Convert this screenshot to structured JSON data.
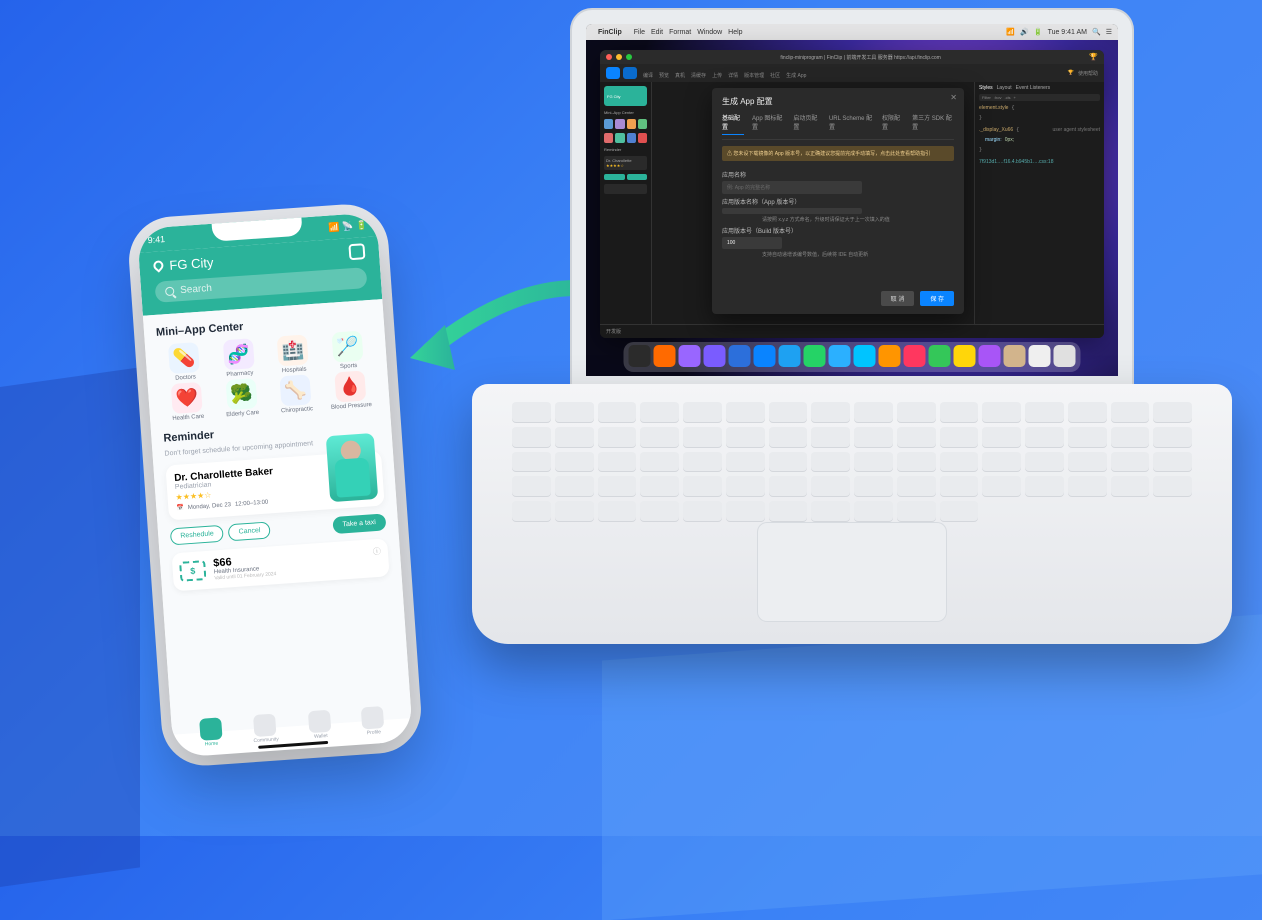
{
  "mac_menubar": {
    "app": "FinClip",
    "menus": [
      "File",
      "Edit",
      "Format",
      "Window",
      "Help"
    ],
    "time": "Tue 9:41 AM"
  },
  "ide": {
    "title": "finclip-miniprogram | FinClip | 前端开发工具 服务器 https://api.finclip.com",
    "toolbar_labels": [
      "编译",
      "预览",
      "真机",
      "清缓存",
      "上传",
      "详情",
      "版本管理",
      "社区",
      "生成 App"
    ],
    "credit_label": "使用帮助",
    "sidebar": {
      "loc": "FG City",
      "section": "Mini–App Center",
      "reminder": "Reminder",
      "doctor": "Dr. Charollette"
    },
    "devtools": {
      "tabs": [
        "Styles",
        "Layout",
        "Event Listeners"
      ],
      "filter": "Filter",
      "hov": ":hov",
      "cls": ".cls",
      "plus": "+",
      "rule_selector": "element.style",
      "rule2_selector": "._display_Xu66",
      "margin_prop": "margin:",
      "margin_val": "0px;",
      "agent": "user agent stylesheet",
      "css_link": "7f913d1….f16.4.b945b1….css:18"
    },
    "bottombar": {
      "label": "开发版"
    }
  },
  "modal": {
    "title": "生成 App 配置",
    "tabs": [
      "基础配置",
      "App 图标配置",
      "启动页配置",
      "URL Scheme 配置",
      "权限配置",
      "第三方 SDK 配置"
    ],
    "warn": "⚠ 您未设下载镜像的 App 版本号，以正确建议您提前完成手动填写，点击此处查看帮助指引",
    "field1_label": "应用名称",
    "field1_placeholder": "例: App 的完整名称",
    "field2_label": "应用版本名称（App 版本号）",
    "field2_hint": "请按照 x.y.z 方式命名，升级时请保证大于上一次填入的值",
    "field3_label": "应用版本号（Build 版本号）",
    "field3_value": "100",
    "field3_hint": "支持自动递增该编号数值，后续将 IDE 自动更新",
    "cancel": "取 消",
    "save": "保 存"
  },
  "phone": {
    "status_time": "9:41",
    "location": "FG City",
    "search_placeholder": "Search",
    "section_title": "Mini–App Center",
    "apps": [
      {
        "label": "Doctors",
        "emoji": "💊",
        "bg": "#eaf4ff"
      },
      {
        "label": "Pharmacy",
        "emoji": "🧬",
        "bg": "#f3eaff"
      },
      {
        "label": "Hospitals",
        "emoji": "🏥",
        "bg": "#fff3ea"
      },
      {
        "label": "Sports",
        "emoji": "🏸",
        "bg": "#eafff1"
      },
      {
        "label": "Health Care",
        "emoji": "❤️",
        "bg": "#ffeaf1"
      },
      {
        "label": "Elderly Care",
        "emoji": "🥦",
        "bg": "#eafff8"
      },
      {
        "label": "Chiropractic",
        "emoji": "🦴",
        "bg": "#eaf2ff"
      },
      {
        "label": "Blood Pressure",
        "emoji": "🩸",
        "bg": "#ffeaea"
      }
    ],
    "reminder_title": "Reminder",
    "reminder_sub": "Don't forget schedule for upcoming appointment",
    "doctor": {
      "name": "Dr. Charollette Baker",
      "spec": "Pediatrician",
      "stars": "★★★★☆",
      "date": "Monday, Dec 23",
      "time": "12:00–13:00"
    },
    "buttons": {
      "reschedule": "Reshedule",
      "cancel": "Cancel",
      "taxi": "Take a taxi"
    },
    "price": {
      "amount": "$66",
      "label": "Health Insurance",
      "sub": "Valid until 01 February 2024",
      "ticket": "$"
    },
    "tabs": [
      {
        "label": "Home",
        "bg": "#2bb39a"
      },
      {
        "label": "Community",
        "bg": "#e5e7eb"
      },
      {
        "label": "Wallet",
        "bg": "#e5e7eb"
      },
      {
        "label": "Profile",
        "bg": "#e5e7eb"
      }
    ]
  },
  "dock_colors": [
    "#2b2b2b",
    "#ff6a00",
    "#9966ff",
    "#7a5cff",
    "#2c6fdb",
    "#0a84ff",
    "#1ea1f2",
    "#25d366",
    "#2bb0ff",
    "#00c4ff",
    "#ff9500",
    "#ff375f",
    "#34c759",
    "#ffd60a",
    "#a855f7",
    "#d2b48c",
    "#efefef",
    "#e0e0e0"
  ]
}
